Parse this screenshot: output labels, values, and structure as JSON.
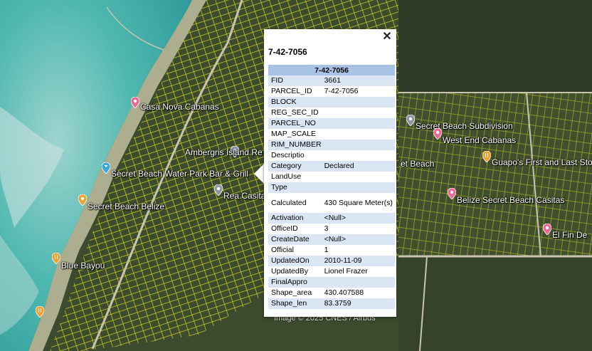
{
  "map": {
    "attribution": "Image © 2025 CNES / Airbus",
    "pois": [
      {
        "id": "casa-nova",
        "label": "Casa Nova Cabanas",
        "color": "#e86a96",
        "icon": "hotel-pin-icon"
      },
      {
        "id": "ambergris",
        "label": "Ambergris Island Re",
        "color": "#8a96a6",
        "icon": "place-pin-icon"
      },
      {
        "id": "water-park",
        "label": "Secret Beach Water Park Bar & Grill",
        "color": "#3fa9d6",
        "icon": "bar-pin-icon"
      },
      {
        "id": "rea-casita",
        "label": "Rea Casita",
        "color": "#8a96a6",
        "icon": "place-pin-icon"
      },
      {
        "id": "secret-beach-belize",
        "label": "Secret Beach Belize",
        "color": "#f0a030",
        "icon": "attraction-pin-icon"
      },
      {
        "id": "blue-bayou",
        "label": "Blue Bayou",
        "color": "#f0a030",
        "icon": "restaurant-pin-icon"
      },
      {
        "id": "unnamed-sw",
        "label": "",
        "color": "#f0a030",
        "icon": "restaurant-pin-icon"
      },
      {
        "id": "secret-beach-subdivision",
        "label": "Secret Beach Subdivision",
        "color": "#8a96a6",
        "icon": "place-pin-icon"
      },
      {
        "id": "west-end-cabanas",
        "label": "West End Cabanas",
        "color": "#e86a96",
        "icon": "hotel-pin-icon"
      },
      {
        "id": "secret-beach-partial",
        "label": "et Beach",
        "color": "#ffffff",
        "icon": ""
      },
      {
        "id": "guapos",
        "label": "Guapo's First and Last Sto",
        "color": "#f0a030",
        "icon": "restaurant-pin-icon"
      },
      {
        "id": "belize-secret-casitas",
        "label": "Belize Secret Beach Casitas",
        "color": "#e86a96",
        "icon": "hotel-pin-icon"
      },
      {
        "id": "el-fin",
        "label": "El Fin De",
        "color": "#e86a96",
        "icon": "hotel-pin-icon"
      }
    ]
  },
  "popup": {
    "title": "7-42-7056",
    "table_header": "7-42-7056",
    "close_symbol": "✕",
    "rows": [
      {
        "key": "FID",
        "value": "3661"
      },
      {
        "key": "PARCEL_ID",
        "value": "7-42-7056"
      },
      {
        "key": "BLOCK",
        "value": ""
      },
      {
        "key": "REG_SEC_ID",
        "value": ""
      },
      {
        "key": "PARCEL_NO",
        "value": ""
      },
      {
        "key": "MAP_SCALE",
        "value": ""
      },
      {
        "key": "RIM_NUMBER",
        "value": ""
      },
      {
        "key": "Descriptio",
        "value": ""
      },
      {
        "key": "Category",
        "value": "Declared"
      },
      {
        "key": "LandUse",
        "value": ""
      },
      {
        "key": "Type",
        "value": ""
      },
      {
        "key": "Calculated",
        "value": "430 Square Meter(s)"
      },
      {
        "key": "Activation",
        "value": "<Null>"
      },
      {
        "key": "OfficeID",
        "value": "3"
      },
      {
        "key": "CreateDate",
        "value": "<Null>"
      },
      {
        "key": "Official",
        "value": "1"
      },
      {
        "key": "UpdatedOn",
        "value": "2010-11-09"
      },
      {
        "key": "UpdatedBy",
        "value": "Lionel Frazer"
      },
      {
        "key": "FinalAppro",
        "value": ""
      },
      {
        "key": "Shape_area",
        "value": "430.407588"
      },
      {
        "key": "Shape_len",
        "value": "83.3759"
      }
    ]
  }
}
